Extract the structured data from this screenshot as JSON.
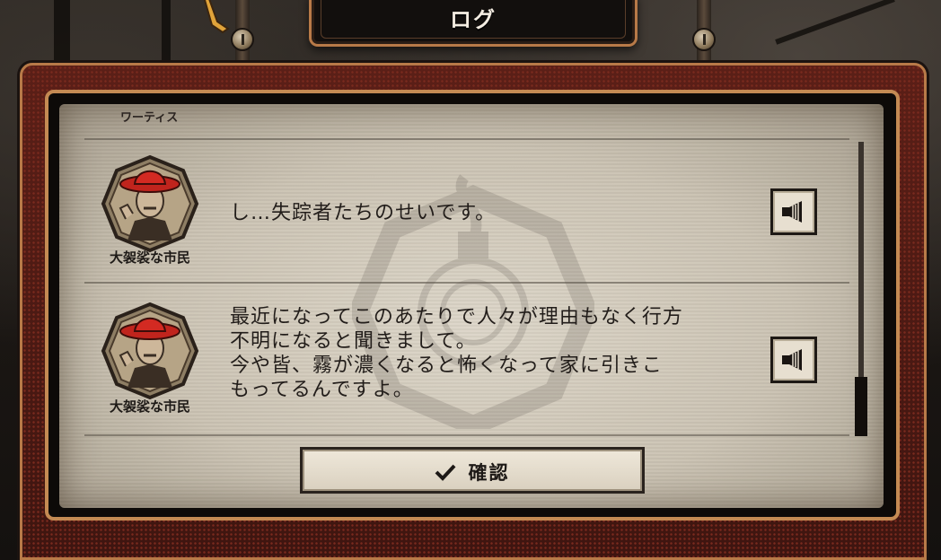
{
  "header": {
    "title": "ログ"
  },
  "log": {
    "previous_speaker": "ワーティス",
    "entries": [
      {
        "speaker": "大袈裟な市民",
        "portrait": "citizen-red-hat-portrait",
        "text": "し…失踪者たちのせいです。",
        "voice_icon": "speaker-icon"
      },
      {
        "speaker": "大袈裟な市民",
        "portrait": "citizen-red-hat-portrait",
        "text": "最近になってこのあたりで人々が理由もなく行方\n不明になると聞きまして。\n今や皆、霧が濃くなると怖くなって家に引きこ\nもってるんですよ。",
        "voice_icon": "speaker-icon"
      }
    ]
  },
  "footer": {
    "confirm_label": "確認",
    "confirm_icon": "checkmark-icon"
  },
  "colors": {
    "frame_copper": "#c48a53",
    "frame_red": "#5b1f17",
    "paper": "#d6cebf",
    "text": "#221d1a"
  }
}
